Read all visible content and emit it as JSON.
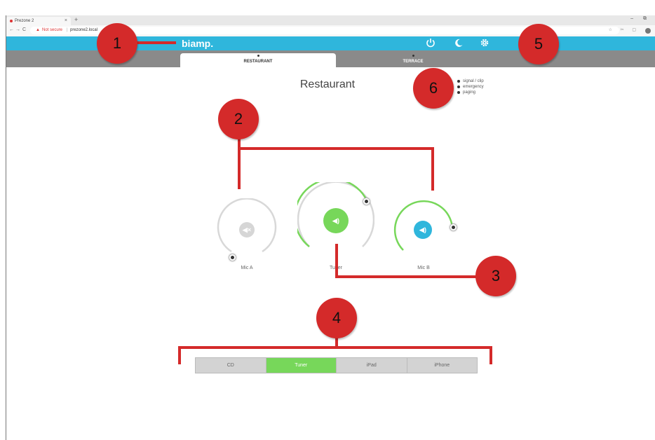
{
  "browser": {
    "tab_title": "Prezone 2",
    "tab_close": "×",
    "new_tab": "+",
    "nav_back": "←",
    "nav_forward": "→",
    "nav_reload": "C",
    "security_icon": "warning-icon",
    "security_label": "Not secure",
    "url": "prezone2.local",
    "window_controls": "– ⧉"
  },
  "app": {
    "logo": "biamp.",
    "header_icons": [
      "power-icon",
      "moon-icon",
      "gear-icon"
    ],
    "accent_color": "#2fb6dc"
  },
  "zones": {
    "tabs": [
      {
        "label": "RESTAURANT",
        "active": true
      },
      {
        "label": "TERRACE",
        "active": false
      }
    ]
  },
  "main": {
    "title": "Restaurant",
    "legend": [
      "signal / clip",
      "emergency",
      "paging"
    ]
  },
  "channels": [
    {
      "label": "Mic A",
      "state": "muted",
      "color": "#cfcfcf",
      "level": 0.0
    },
    {
      "label": "Tuner",
      "state": "active",
      "color": "#77d75a",
      "level": 0.82
    },
    {
      "label": "Mic B",
      "state": "active",
      "color": "#2fb6dc",
      "level": 0.6
    }
  ],
  "sources": {
    "items": [
      "CD",
      "Tuner",
      "iPad",
      "iPhone"
    ],
    "selected": "Tuner",
    "selected_color": "#77d75a"
  },
  "annotations": {
    "callouts": [
      "1",
      "2",
      "3",
      "4",
      "5",
      "6"
    ],
    "color": "#d42a2a"
  }
}
